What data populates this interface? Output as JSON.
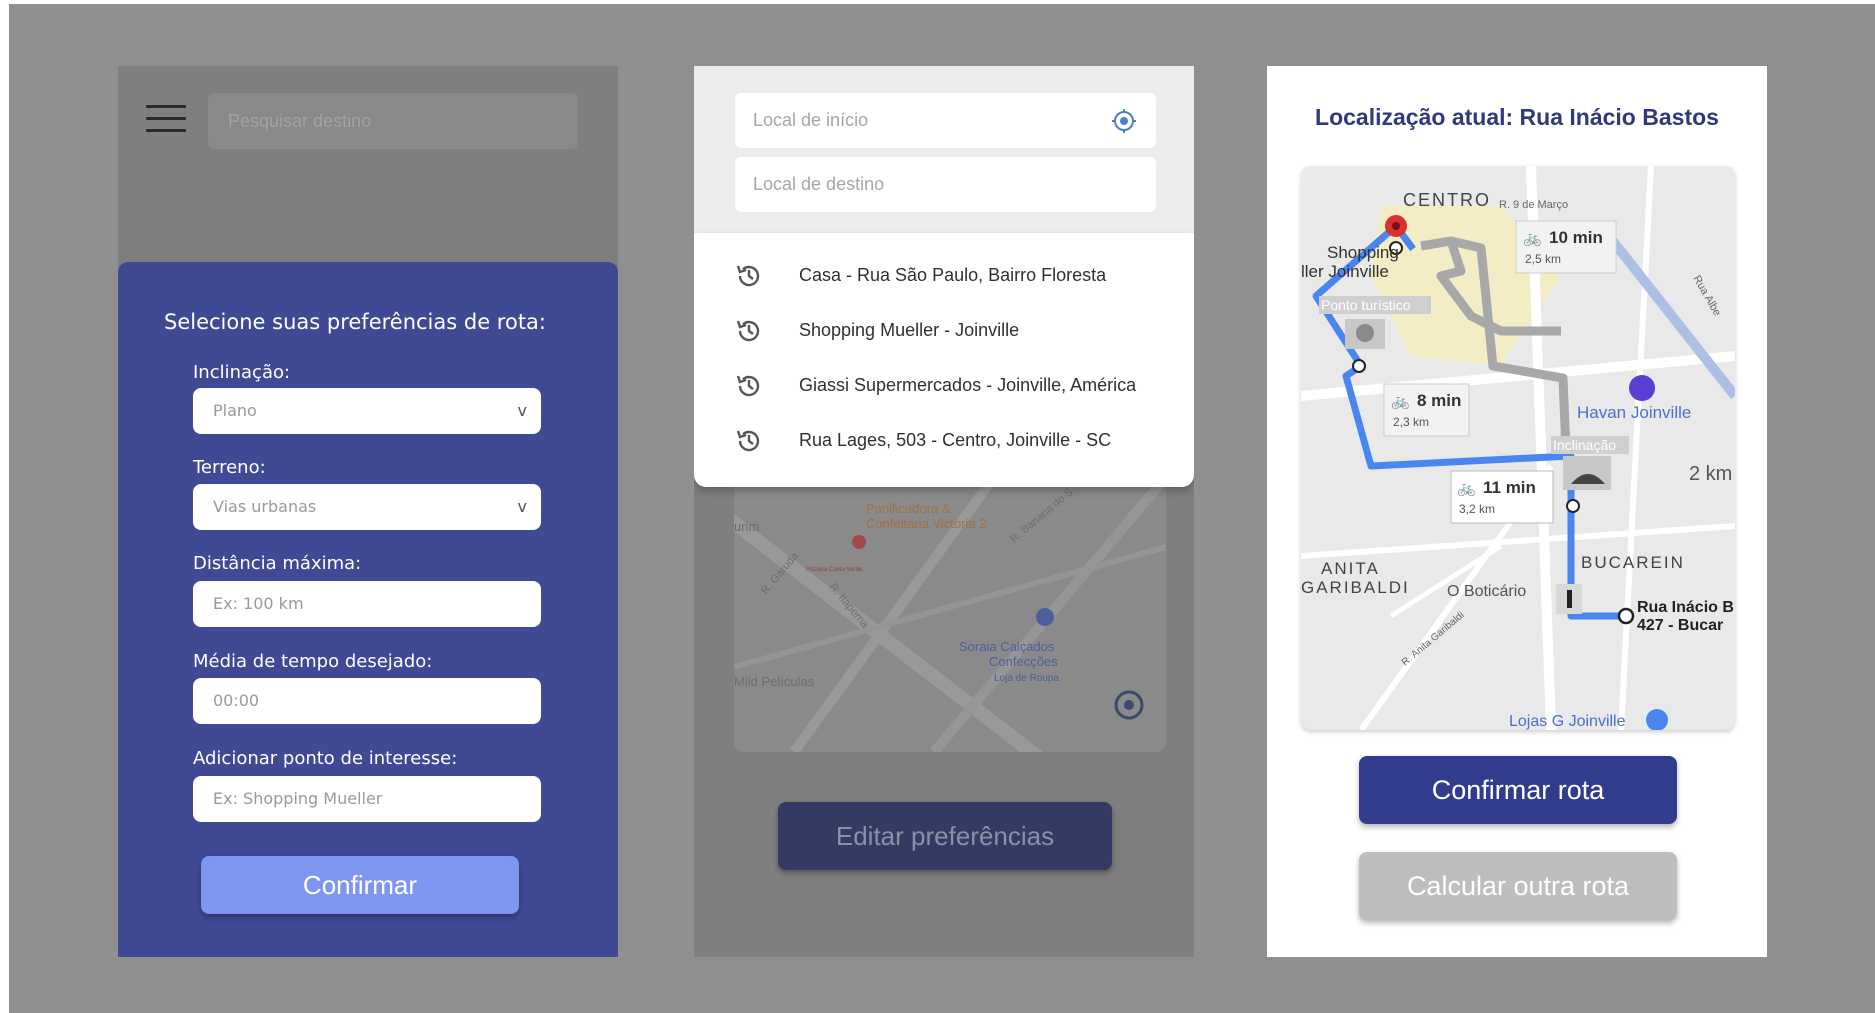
{
  "screen1": {
    "search_placeholder": "Pesquisar destino",
    "heading": "Selecione suas preferências de rota:",
    "fields": [
      {
        "label": "Inclinação:",
        "value": "Plano",
        "chevron": "v"
      },
      {
        "label": "Terreno:",
        "value": "Vias urbanas",
        "chevron": "v"
      },
      {
        "label": "Distância máxima:",
        "placeholder": "Ex: 100 km"
      },
      {
        "label": "Média de tempo desejado:",
        "placeholder": "00:00"
      },
      {
        "label": "Adicionar ponto de interesse:",
        "placeholder": "Ex: Shopping Mueller"
      }
    ],
    "confirm_label": "Confirmar",
    "accent": "#404a94"
  },
  "screen2": {
    "start_placeholder": "Local de início",
    "dest_placeholder": "Local de destino",
    "history": [
      "Casa - Rua São Paulo, Bairro Floresta",
      "Shopping Mueller - Joinville",
      "Giassi Supermercados - Joinville, América",
      "Rua Lages, 503 - Centro, Joinville - SC"
    ],
    "map_labels": {
      "panificadora": "Panificadora &",
      "confeitaria": "Confeitaria Victoria 2",
      "urim": "urim",
      "garuda": "R. Garuda",
      "itaperna": "R. Itaperna",
      "soraia1": "Soraia Calçados",
      "soraia2": "Confecções",
      "soraia3": "Loja de Roupa",
      "mild": "Mild Películas",
      "banana": "R. Banana do S.",
      "pizza": "Pizzaria Canto Verde"
    },
    "edit_label": "Editar preferências"
  },
  "screen3": {
    "title": "Localização atual: Rua Inácio Bastos",
    "map": {
      "centro": "CENTRO",
      "r9marco": "R. 9 de Março",
      "shopping1": "Shopping",
      "shopping2": "ller Joinville",
      "ponto": "Ponto turístico",
      "ralbe": "Rua Albe",
      "havan": "Havan Joinville",
      "inclinacao": "Inclinação",
      "scale": "2 km",
      "anita1": "ANITA",
      "anita2": "GARIBALDI",
      "bucarein": "BUCAREIN",
      "boticario": "O Boticário",
      "rua_inacio1": "Rua Inácio B",
      "rua_inacio2": "427 - Bucar",
      "ranita": "R. Anita Garibaldi",
      "lojas": "Lojas G Joinville",
      "routes": [
        {
          "time": "10 min",
          "dist": "2,5 km"
        },
        {
          "time": "8 min",
          "dist": "2,3 km"
        },
        {
          "time": "11 min",
          "dist": "3,2 km"
        }
      ]
    },
    "confirm_label": "Confirmar rota",
    "other_label": "Calcular outra rota",
    "route_color": "#4a86f0"
  }
}
